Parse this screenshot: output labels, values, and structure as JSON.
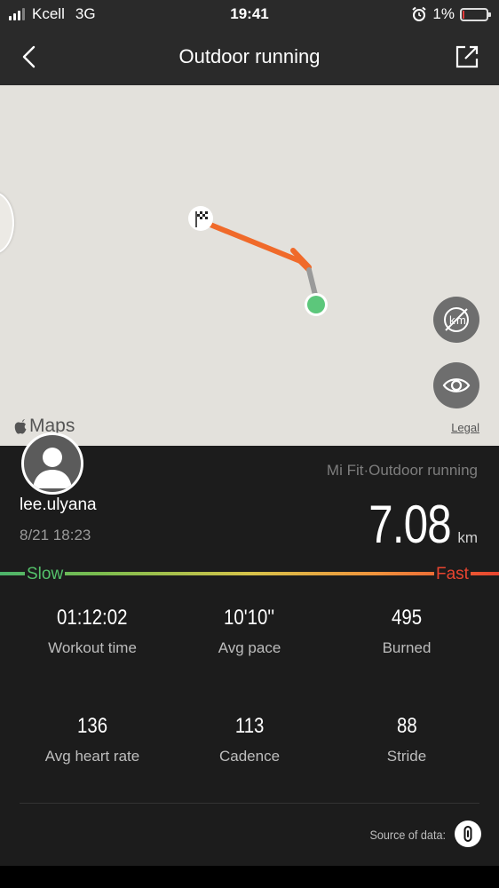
{
  "status_bar": {
    "carrier": "Kcell",
    "network": "3G",
    "time": "19:41",
    "battery": "1%",
    "alarm_icon": "alarm-clock-icon"
  },
  "nav": {
    "title": "Outdoor running",
    "back_icon": "chevron-left-icon",
    "share_icon": "share-icon"
  },
  "map": {
    "provider_label": "Maps",
    "legal_label": "Legal",
    "route_color": "#f06a2a",
    "start_color": "#5cc77b",
    "buttons": [
      {
        "name": "km-markers-toggle",
        "icon": "km-off-icon"
      },
      {
        "name": "visibility-toggle",
        "icon": "eye-icon"
      }
    ]
  },
  "profile": {
    "username": "lee.ulyana",
    "datetime": "8/21 18:23"
  },
  "summary": {
    "source": "Mi Fit·Outdoor running",
    "distance": "7.08",
    "distance_unit": "km"
  },
  "pace_scale": {
    "slow_label": "Slow",
    "fast_label": "Fast",
    "slow_color": "#54c16a",
    "fast_color": "#e8442f"
  },
  "stats": [
    {
      "value": "01:12:02",
      "label": "Workout time"
    },
    {
      "value": "10'10''",
      "label": "Avg pace"
    },
    {
      "value": "495",
      "label": "Burned"
    },
    {
      "value": "136",
      "label": "Avg heart rate"
    },
    {
      "value": "113",
      "label": "Cadence"
    },
    {
      "value": "88",
      "label": "Stride"
    }
  ],
  "footer": {
    "source_of_data_label": "Source of data:",
    "source_icon": "device-icon"
  }
}
